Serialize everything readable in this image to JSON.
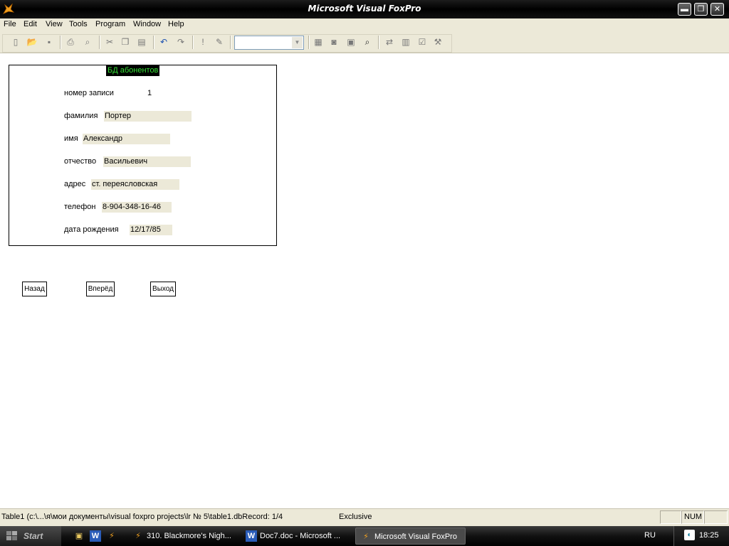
{
  "window": {
    "title": "Microsoft Visual FoxPro",
    "minimize_glyph": "▬",
    "maximize_glyph": "❐",
    "close_glyph": "✕",
    "app_icon": "foxpro-fox-icon"
  },
  "menu": [
    "File",
    "Edit",
    "View",
    "Tools",
    "Program",
    "Window",
    "Help"
  ],
  "toolbar": {
    "icons": [
      "new-icon",
      "open-icon",
      "save-icon",
      "print-icon",
      "print-preview-icon",
      "cut-icon",
      "copy-icon",
      "paste-icon",
      "undo-icon",
      "redo-icon",
      "run-icon",
      "modify-form-icon",
      "combo",
      "database-icon",
      "command-window-icon",
      "form-designer-icon",
      "report-icon",
      "class-browser-icon",
      "data-session-icon",
      "properties-icon",
      "tools-icon"
    ],
    "combo_value": ""
  },
  "form": {
    "title": "БД абонентов",
    "fields": [
      {
        "label": "номер записи",
        "value": "1"
      },
      {
        "label": "фамилия",
        "value": "Портер"
      },
      {
        "label": "имя",
        "value": "Александр"
      },
      {
        "label": "отчество",
        "value": "Васильевич"
      },
      {
        "label": "адрес",
        "value": "ст. переясловская"
      },
      {
        "label": "телефон",
        "value": "8-904-348-16-46"
      },
      {
        "label": "дата рождения",
        "value": "12/17/85"
      }
    ],
    "buttons": {
      "back": "Назад",
      "forward": "Вперёд",
      "exit": "Выход"
    }
  },
  "statusbar": {
    "main": "Table1 (c:\\...\\я\\мои документы\\visual foxpro projects\\lr № 5\\table1.dbRecord: 1/4",
    "mode": "Exclusive",
    "num": "NUM"
  },
  "taskbar": {
    "start": "Start",
    "tasks": [
      "310. Blackmore's Nigh...",
      "Doc7.doc - Microsoft ...",
      "Microsoft Visual FoxPro"
    ],
    "language": "RU",
    "clock": "18:25"
  },
  "colors": {
    "form_title_fg": "#36e036",
    "form_title_bg": "#000000",
    "field_bg": "#ece9d8",
    "chrome": "#ece9d8"
  }
}
